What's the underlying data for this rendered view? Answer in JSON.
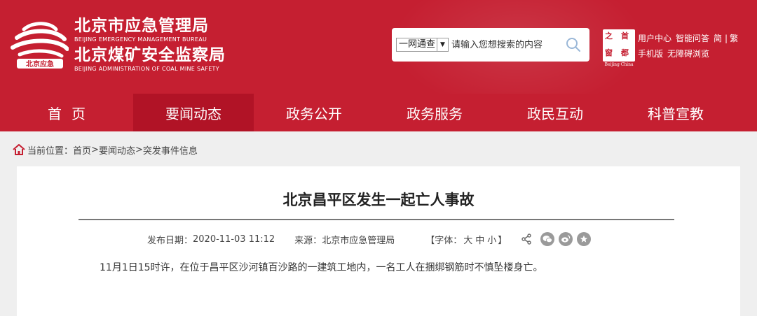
{
  "header": {
    "org1_cn": "北京市应急管理局",
    "org1_en": "BEIJING   EMERGENCY MANAGEMENT BUREAU",
    "org2_cn": "北京煤矿安全监察局",
    "org2_en": "BEIJING   ADMINISTRATION OF COAL MINE SAFETY",
    "logo_badge": "北京应急",
    "brand_color": "#c51f31"
  },
  "search": {
    "scope_value": "一网通查",
    "placeholder": "请输入您想搜索的内容"
  },
  "capital_logo": {
    "chars": [
      "之",
      "首",
      "窗",
      "都"
    ],
    "caption": "Beijing·China"
  },
  "toplinks": {
    "user_center": "用户中心",
    "smart_qa": "智能问答",
    "simplified": "简",
    "separator": "|",
    "traditional": "繁",
    "mobile": "手机版",
    "accessible": "无障碍浏览"
  },
  "nav": {
    "items": [
      {
        "label": "首页"
      },
      {
        "label": "要闻动态"
      },
      {
        "label": "政务公开"
      },
      {
        "label": "政务服务"
      },
      {
        "label": "政民互动"
      },
      {
        "label": "科普宣教"
      }
    ],
    "active_index": 1
  },
  "breadcrumb": {
    "prefix": "当前位置：",
    "home": "首页",
    "sep": ">",
    "section": "要闻动态",
    "page": "突发事件信息"
  },
  "article": {
    "title": "北京昌平区发生一起亡人事故",
    "date_label": "发布日期：",
    "date": "2020-11-03 11:12",
    "source_label": "来源：",
    "source": "北京市应急管理局",
    "font_open": "【字体：",
    "font_large": "大",
    "font_medium": "中",
    "font_small": "小",
    "font_close": "】",
    "body": "11月1日15时许，在位于昌平区沙河镇百沙路的一建筑工地内，一名工人在捆绑钢筋时不慎坠楼身亡。"
  }
}
